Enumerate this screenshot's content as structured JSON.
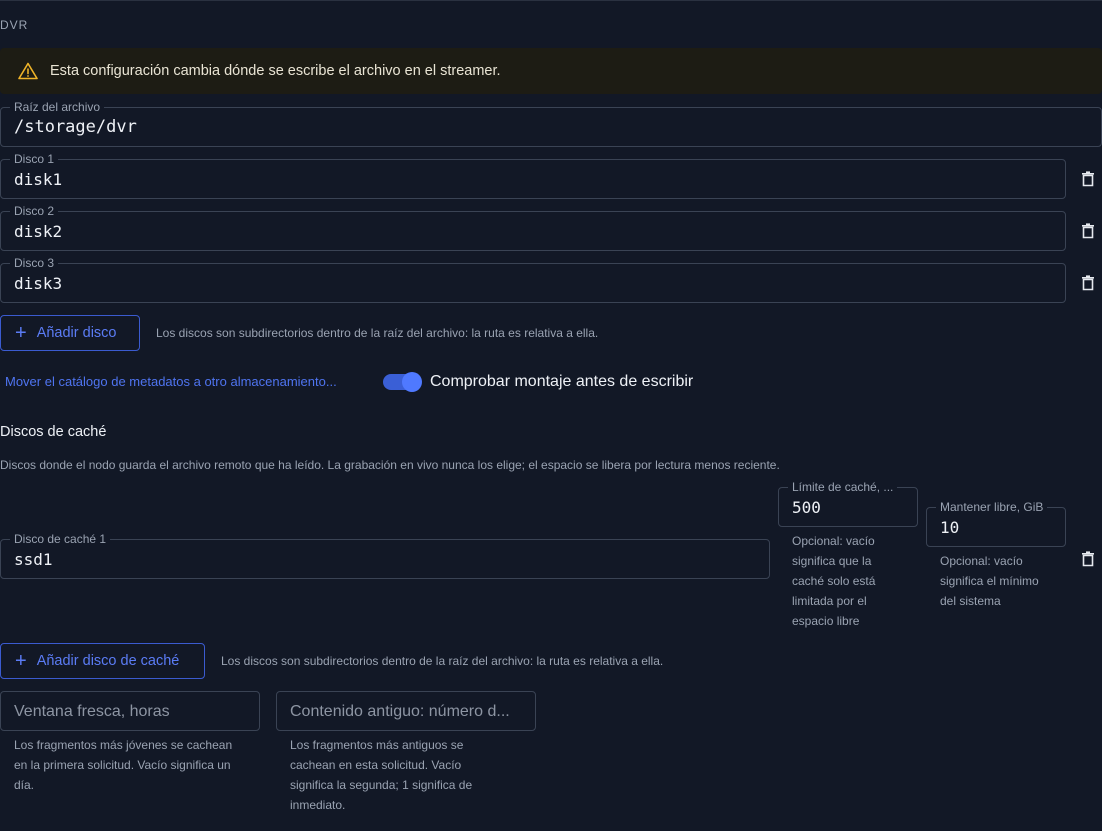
{
  "section": {
    "label": "DVR"
  },
  "warning": {
    "text": "Esta configuración cambia dónde se escribe el archivo en el streamer."
  },
  "archive_root": {
    "label": "Raíz del archivo",
    "value": "/storage/dvr"
  },
  "disks": [
    {
      "label": "Disco 1",
      "value": "disk1"
    },
    {
      "label": "Disco 2",
      "value": "disk2"
    },
    {
      "label": "Disco 3",
      "value": "disk3"
    }
  ],
  "add_disk": {
    "label": "Añadir disco",
    "hint": "Los discos son subdirectorios dentro de la raíz del archivo: la ruta es relativa a ella."
  },
  "metadata_link": {
    "label": "Mover el catálogo de metadatos a otro almacenamiento..."
  },
  "mount_check": {
    "label": "Comprobar montaje antes de escribir",
    "enabled": true
  },
  "cache": {
    "title": "Discos de caché",
    "description": "Discos donde el nodo guarda el archivo remoto que ha leído. La grabación en vivo nunca los elige; el espacio se libera por lectura menos reciente.",
    "disk": {
      "label": "Disco de caché 1",
      "value": "ssd1"
    },
    "limit": {
      "label": "Límite de caché, ...",
      "value": "500",
      "help": [
        "Opcional: vacío",
        "significa que la",
        "caché solo está",
        "limitada por el",
        "espacio libre"
      ]
    },
    "keep_free": {
      "label": "Mantener libre, GiB",
      "value": "10",
      "help": [
        "Opcional: vacío",
        "significa el mínimo",
        "del sistema"
      ]
    },
    "add": {
      "label": "Añadir disco de caché",
      "hint": "Los discos son subdirectorios dentro de la raíz del archivo: la ruta es relativa a ella."
    }
  },
  "fresh_window": {
    "placeholder": "Ventana fresca, horas",
    "help": [
      "Los fragmentos más jóvenes se cachean",
      "en la primera solicitud. Vacío significa un",
      "día."
    ]
  },
  "old_content": {
    "placeholder": "Contenido antiguo: número d...",
    "help": [
      "Los fragmentos más antiguos se",
      "cachean en esta solicitud. Vacío",
      "significa la segunda; 1 significa de",
      "inmediato."
    ]
  },
  "colors": {
    "accent": "#4f74f0",
    "background": "#121826",
    "warning_bg": "#1d1c14",
    "warning_icon": "#f0b429"
  }
}
